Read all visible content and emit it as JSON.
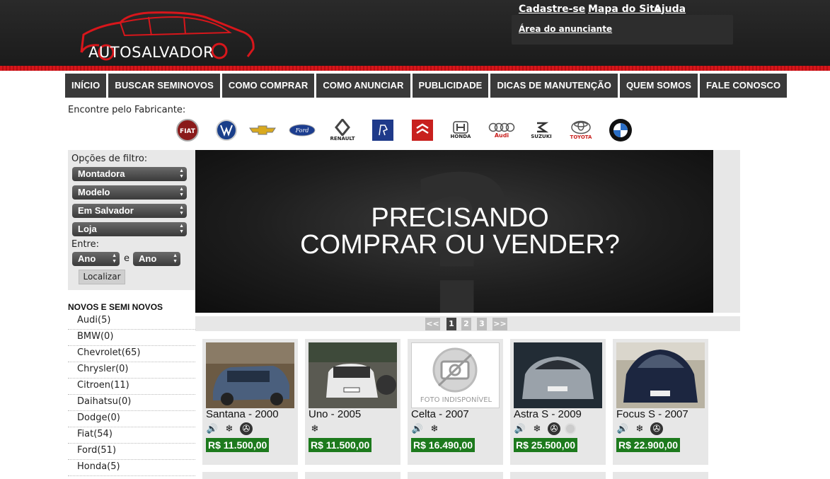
{
  "header": {
    "logo_text": "AUTOSALVADOR",
    "links": {
      "register": "Cadastre-se",
      "sitemap": "Mapa do Site",
      "help": "Ajuda",
      "advertiser": "Área do anunciante"
    },
    "brand_color": "#d8161b"
  },
  "nav": [
    "INÍCIO",
    "BUSCAR SEMINOVOS",
    "COMO COMPRAR",
    "COMO ANUNCIAR",
    "PUBLICIDADE",
    "DICAS DE MANUTENÇÃO",
    "QUEM SOMOS",
    "FALE CONOSCO"
  ],
  "brands": {
    "label": "Encontre pelo Fabricante:",
    "items": [
      "FIAT",
      "VW",
      "CHEVROLET",
      "Ford",
      "RENAULT",
      "PEUGEOT",
      "CITROËN",
      "HONDA",
      "Audi",
      "SUZUKI",
      "TOYOTA",
      "BMW"
    ]
  },
  "filter": {
    "title": "Opções de filtro:",
    "selects": {
      "make": "Montadora",
      "model": "Modelo",
      "city": "Em Salvador",
      "store": "Loja",
      "year_from": "Ano",
      "year_to": "Ano"
    },
    "between": "Entre:",
    "and": "e",
    "button": "Localizar"
  },
  "categories": {
    "title": "NOVOS E SEMI NOVOS",
    "items": [
      "Audi(5)",
      "BMW(0)",
      "Chevrolet(65)",
      "Chrysler(0)",
      "Citroen(11)",
      "Daihatsu(0)",
      "Dodge(0)",
      "Fiat(54)",
      "Ford(51)",
      "Honda(5)"
    ]
  },
  "banner": {
    "line1": "PRECISANDO",
    "line2": "COMPRAR OU VENDER?"
  },
  "pager": {
    "prev": "<<",
    "pages": [
      "1",
      "2",
      "3"
    ],
    "current": "1",
    "next": ">>"
  },
  "cars": [
    {
      "title": "Santana - 2000",
      "price": "R$ 11.500,00",
      "features": [
        "sound-icon",
        "ac-icon",
        "steering-icon"
      ]
    },
    {
      "title": "Uno - 2005",
      "price": "R$ 11.500,00",
      "features": [
        "ac-icon"
      ]
    },
    {
      "title": "Celta - 2007",
      "price": "R$ 16.490,00",
      "features": [
        "sound-icon",
        "ac-icon"
      ],
      "photo_placeholder": "FOTO INDISPONÍVEL"
    },
    {
      "title": "Astra S - 2009",
      "price": "R$ 25.500,00",
      "features": [
        "sound-icon",
        "ac-icon",
        "steering-icon",
        "disc-icon"
      ]
    },
    {
      "title": "Focus S - 2007",
      "price": "R$ 22.900,00",
      "features": [
        "sound-icon",
        "ac-icon",
        "steering-icon"
      ]
    }
  ],
  "colors": {
    "price_bg": "#1d7a1d",
    "nav_bg": "#3a3a3a",
    "panel_bg": "#e7e7e7"
  }
}
